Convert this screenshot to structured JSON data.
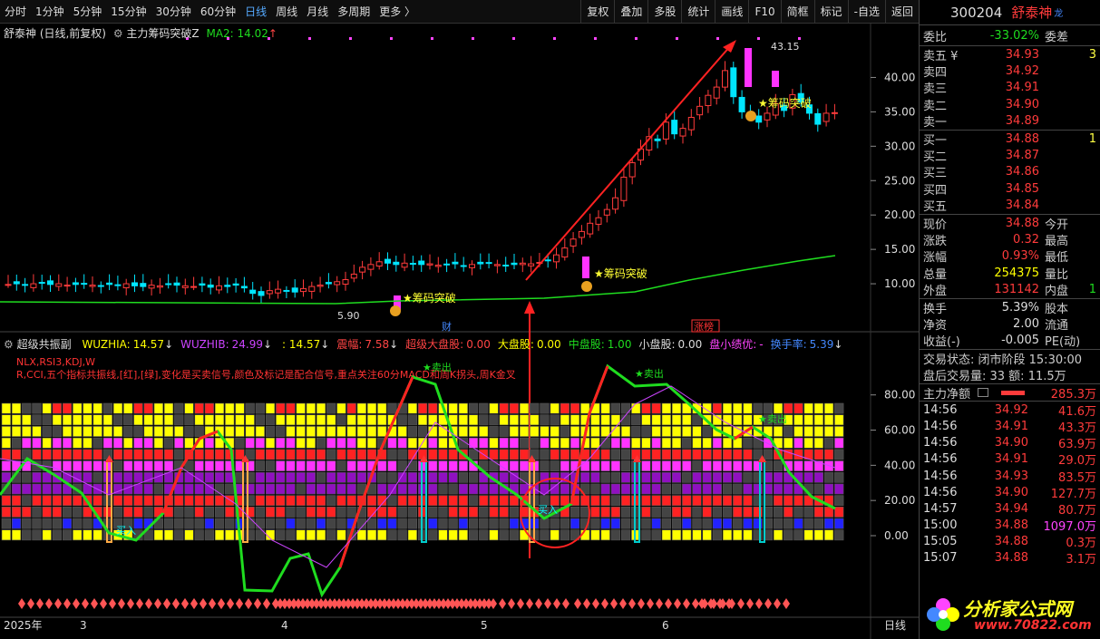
{
  "toolbar": {
    "periods": [
      "分时",
      "1分钟",
      "5分钟",
      "15分钟",
      "30分钟",
      "60分钟",
      "日线",
      "周线",
      "月线",
      "多周期",
      "更多 〉"
    ],
    "active": "日线",
    "tools": [
      "复权",
      "叠加",
      "多股",
      "统计",
      "画线",
      "F10",
      "简框",
      "标记",
      "-自选",
      "返回"
    ]
  },
  "main_chart": {
    "title": "舒泰神 (日线,前复权)",
    "indicator": "主力筹码突破Z",
    "ma_label": "MA2: 14.02",
    "ma_arrow": "↑",
    "high_label": "43.15",
    "low_label": "5.90",
    "signal_label": "★筹码突破",
    "price_ticks": [
      "40.00",
      "35.00",
      "30.00",
      "25.00",
      "20.00",
      "15.00",
      "10.00"
    ],
    "event_cai": "财",
    "event_zb": "涨榜"
  },
  "sub_chart": {
    "name": "超级共振副",
    "params": [
      {
        "k": "WUZHIA:",
        "v": "14.57",
        "c": "#ff0",
        "a": "↓"
      },
      {
        "k": "WUZHIB:",
        "v": "24.99",
        "c": "#c4f",
        "a": "↓"
      },
      {
        "k": "",
        "v": ": 14.57",
        "c": "#ff0",
        "a": "↓"
      },
      {
        "k": "震幅:",
        "v": "7.58",
        "c": "#f44",
        "a": "↓"
      },
      {
        "k": "超级大盘股:",
        "v": "0.00",
        "c": "#f44",
        "a": ""
      },
      {
        "k": "大盘股:",
        "v": "0.00",
        "c": "#ff0",
        "a": ""
      },
      {
        "k": "中盘股:",
        "v": "1.00",
        "c": "#1fdc1f",
        "a": ""
      },
      {
        "k": "小盘股:",
        "v": "0.00",
        "c": "#ddd",
        "a": ""
      },
      {
        "k": "盘小绩优:",
        "v": "-",
        "c": "#f4f",
        "a": ""
      },
      {
        "k": "换手率:",
        "v": "5.39",
        "c": "#48f",
        "a": "↓"
      }
    ],
    "desc1": "NLX,RSI3,KDJ,W",
    "desc2": "R,CCI,五个指标共振线,[红],[绿],变化是买卖信号,颜色及标记是配合信号,重点关注60分MACD和周K拐头,周K金叉",
    "ticks": [
      "80.00",
      "60.00",
      "40.00",
      "20.00",
      "0.00"
    ],
    "sell": "★卖出",
    "buy": "买入",
    "watermark": "分析家公式网"
  },
  "dates": [
    "2025年",
    "3",
    "4",
    "5",
    "6"
  ],
  "period_tag": "日线",
  "quote": {
    "code": "300204",
    "name": "舒泰神",
    "wb": {
      "l": "委比",
      "v": "-33.02%",
      "r": "委差"
    },
    "asks": [
      {
        "l": "卖五 ¥",
        "p": "34.93",
        "v": "3"
      },
      {
        "l": "卖四",
        "p": "34.92",
        "v": ""
      },
      {
        "l": "卖三",
        "p": "34.91",
        "v": ""
      },
      {
        "l": "卖二",
        "p": "34.90",
        "v": ""
      },
      {
        "l": "卖一",
        "p": "34.89",
        "v": ""
      }
    ],
    "bids": [
      {
        "l": "买一",
        "p": "34.88",
        "v": "1"
      },
      {
        "l": "买二",
        "p": "34.87",
        "v": ""
      },
      {
        "l": "买三",
        "p": "34.86",
        "v": ""
      },
      {
        "l": "买四",
        "p": "34.85",
        "v": ""
      },
      {
        "l": "买五",
        "p": "34.84",
        "v": ""
      }
    ],
    "stats": [
      {
        "l": "现价",
        "v": "34.88",
        "c": "#ff3b3b",
        "r": "今开"
      },
      {
        "l": "涨跌",
        "v": "0.32",
        "c": "#ff3b3b",
        "r": "最高"
      },
      {
        "l": "涨幅",
        "v": "0.93%",
        "c": "#ff3b3b",
        "r": "最低"
      },
      {
        "l": "总量",
        "v": "254375",
        "c": "#ff0",
        "r": "量比"
      },
      {
        "l": "外盘",
        "v": "131142",
        "c": "#ff3b3b",
        "r": "内盘",
        "x": "1"
      }
    ],
    "stats2": [
      {
        "l": "换手",
        "v": "5.39%",
        "r": "股本"
      },
      {
        "l": "净资",
        "v": "2.00",
        "r": "流通"
      },
      {
        "l": "收益(-)",
        "v": "-0.005",
        "r": "PE(动)"
      }
    ],
    "status": "交易状态: 闭市阶段 15:30:00",
    "volume_line": "盘后交易量: 33  额: 11.5万",
    "net": {
      "l": "主力净额",
      "v": "285.3万"
    },
    "ticks": [
      {
        "t": "14:56",
        "p": "34.92",
        "v": "41.6万",
        "pc": "#ff3b3b",
        "vc": "#ff3b3b"
      },
      {
        "t": "14:56",
        "p": "34.91",
        "v": "43.3万",
        "pc": "#ff3b3b",
        "vc": "#ff3b3b"
      },
      {
        "t": "14:56",
        "p": "34.90",
        "v": "63.9万",
        "pc": "#ff3b3b",
        "vc": "#ff3b3b"
      },
      {
        "t": "14:56",
        "p": "34.91",
        "v": "29.0万",
        "pc": "#ff3b3b",
        "vc": "#ff3b3b"
      },
      {
        "t": "14:56",
        "p": "34.93",
        "v": "83.5万",
        "pc": "#ff3b3b",
        "vc": "#ff3b3b"
      },
      {
        "t": "14:56",
        "p": "34.90",
        "v": "127.7万",
        "pc": "#ff3b3b",
        "vc": "#ff3b3b"
      },
      {
        "t": "14:57",
        "p": "34.94",
        "v": "80.7万",
        "pc": "#ff3b3b",
        "vc": "#ff3b3b"
      },
      {
        "t": "15:00",
        "p": "34.88",
        "v": "1097.0万",
        "pc": "#ff3b3b",
        "vc": "#f4f"
      },
      {
        "t": "15:05",
        "p": "34.88",
        "v": "0.3万",
        "pc": "#ff3b3b",
        "vc": "#ff3b3b"
      },
      {
        "t": "15:07",
        "p": "34.88",
        "v": "3.1万",
        "pc": "#ff3b3b",
        "vc": "#ff3b3b"
      }
    ],
    "site": "www.70822.com"
  },
  "colors": {
    "up": "#ff3b3b",
    "down": "#00e5ff",
    "ma": "#1fdc1f",
    "bg": "#000000"
  }
}
